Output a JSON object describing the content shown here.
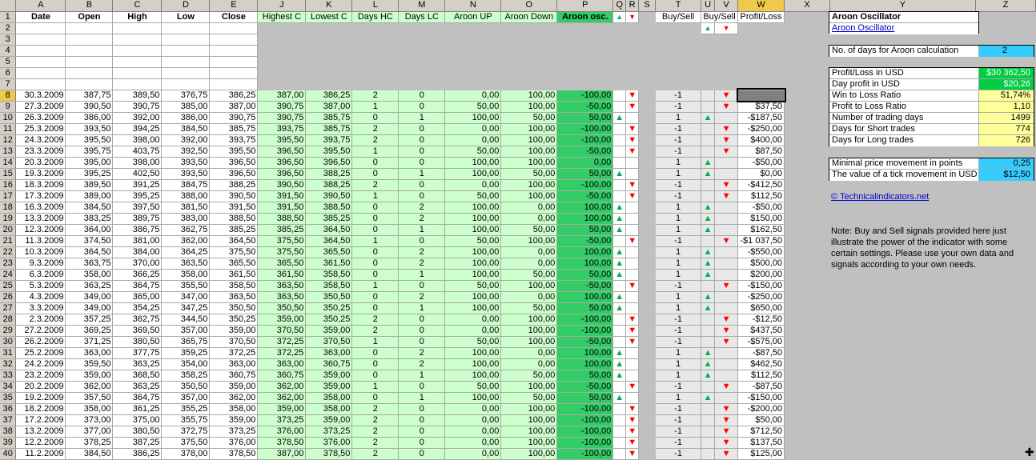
{
  "columns": [
    "A",
    "B",
    "C",
    "D",
    "E",
    "J",
    "K",
    "L",
    "M",
    "N",
    "O",
    "P",
    "Q",
    "R",
    "S",
    "T",
    "U",
    "V",
    "W",
    "X",
    "Y",
    "Z"
  ],
  "row_numbers": [
    "1",
    "2",
    "3",
    "4",
    "5",
    "6",
    "7",
    "8",
    "9",
    "10",
    "11",
    "12",
    "13",
    "14",
    "15",
    "16",
    "17",
    "18",
    "19",
    "20",
    "21",
    "22",
    "23",
    "24",
    "25",
    "26",
    "27",
    "28",
    "29",
    "30",
    "31",
    "32",
    "33",
    "34",
    "35",
    "36",
    "37",
    "38",
    "39",
    "40"
  ],
  "headers": {
    "date": "Date",
    "open": "Open",
    "high": "High",
    "low": "Low",
    "close": "Close",
    "highest_c": "Highest C",
    "lowest_c": "Lowest C",
    "days_hc": "Days HC",
    "days_lc": "Days LC",
    "aroon_up": "Aroon UP",
    "aroon_down": "Aroon Down",
    "aroon_osc": "Aroon osc.",
    "buy_sell": "Buy/Sell",
    "buy_sell2": "Buy/Sell",
    "profit_loss": "Profit/Loss"
  },
  "arrows": {
    "up": "▲",
    "down": "▼"
  },
  "rows": [
    [
      "30.3.2009",
      "387,75",
      "389,50",
      "376,75",
      "386,25",
      "387,00",
      "386,25",
      "2",
      "0",
      "0,00",
      "100,00",
      "-100,00",
      "",
      "▼",
      "",
      "-1",
      "",
      "▼",
      ""
    ],
    [
      "27.3.2009",
      "390,50",
      "390,75",
      "385,00",
      "387,00",
      "390,75",
      "387,00",
      "1",
      "0",
      "50,00",
      "100,00",
      "-50,00",
      "",
      "▼",
      "",
      "-1",
      "",
      "▼",
      "$37,50"
    ],
    [
      "26.3.2009",
      "386,00",
      "392,00",
      "386,00",
      "390,75",
      "390,75",
      "385,75",
      "0",
      "1",
      "100,00",
      "50,00",
      "50,00",
      "▲",
      "",
      "",
      "1",
      "▲",
      "",
      "-$187,50"
    ],
    [
      "25.3.2009",
      "393,50",
      "394,25",
      "384,50",
      "385,75",
      "393,75",
      "385,75",
      "2",
      "0",
      "0,00",
      "100,00",
      "-100,00",
      "",
      "▼",
      "",
      "-1",
      "",
      "▼",
      "-$250,00"
    ],
    [
      "24.3.2009",
      "395,50",
      "398,00",
      "392,00",
      "393,75",
      "395,50",
      "393,75",
      "2",
      "0",
      "0,00",
      "100,00",
      "-100,00",
      "",
      "▼",
      "",
      "-1",
      "",
      "▼",
      "$400,00"
    ],
    [
      "23.3.2009",
      "395,75",
      "403,75",
      "392,50",
      "395,50",
      "396,50",
      "395,50",
      "1",
      "0",
      "50,00",
      "100,00",
      "-50,00",
      "",
      "▼",
      "",
      "-1",
      "",
      "▼",
      "$87,50"
    ],
    [
      "20.3.2009",
      "395,00",
      "398,00",
      "393,50",
      "396,50",
      "396,50",
      "396,50",
      "0",
      "0",
      "100,00",
      "100,00",
      "0,00",
      "",
      "",
      "",
      "1",
      "▲",
      "",
      "-$50,00"
    ],
    [
      "19.3.2009",
      "395,25",
      "402,50",
      "393,50",
      "396,50",
      "396,50",
      "388,25",
      "0",
      "1",
      "100,00",
      "50,00",
      "50,00",
      "▲",
      "",
      "",
      "1",
      "▲",
      "",
      "$0,00"
    ],
    [
      "18.3.2009",
      "389,50",
      "391,25",
      "384,75",
      "388,25",
      "390,50",
      "388,25",
      "2",
      "0",
      "0,00",
      "100,00",
      "-100,00",
      "",
      "▼",
      "",
      "-1",
      "",
      "▼",
      "-$412,50"
    ],
    [
      "17.3.2009",
      "389,00",
      "395,25",
      "388,00",
      "390,50",
      "391,50",
      "390,50",
      "1",
      "0",
      "50,00",
      "100,00",
      "-50,00",
      "",
      "▼",
      "",
      "-1",
      "",
      "▼",
      "$112,50"
    ],
    [
      "16.3.2009",
      "384,50",
      "397,50",
      "381,50",
      "391,50",
      "391,50",
      "388,50",
      "0",
      "2",
      "100,00",
      "0,00",
      "100,00",
      "▲",
      "",
      "",
      "1",
      "▲",
      "",
      "-$50,00"
    ],
    [
      "13.3.2009",
      "383,25",
      "389,75",
      "383,00",
      "388,50",
      "388,50",
      "385,25",
      "0",
      "2",
      "100,00",
      "0,00",
      "100,00",
      "▲",
      "",
      "",
      "1",
      "▲",
      "",
      "$150,00"
    ],
    [
      "12.3.2009",
      "364,00",
      "386,75",
      "362,75",
      "385,25",
      "385,25",
      "364,50",
      "0",
      "1",
      "100,00",
      "50,00",
      "50,00",
      "▲",
      "",
      "",
      "1",
      "▲",
      "",
      "$162,50"
    ],
    [
      "11.3.2009",
      "374,50",
      "381,00",
      "362,00",
      "364,50",
      "375,50",
      "364,50",
      "1",
      "0",
      "50,00",
      "100,00",
      "-50,00",
      "",
      "▼",
      "",
      "-1",
      "",
      "▼",
      "-$1 037,50"
    ],
    [
      "10.3.2009",
      "364,50",
      "384,00",
      "364,25",
      "375,50",
      "375,50",
      "365,50",
      "0",
      "2",
      "100,00",
      "0,00",
      "100,00",
      "▲",
      "",
      "",
      "1",
      "▲",
      "",
      "-$550,00"
    ],
    [
      "9.3.2009",
      "363,75",
      "370,00",
      "363,50",
      "365,50",
      "365,50",
      "361,50",
      "0",
      "2",
      "100,00",
      "0,00",
      "100,00",
      "▲",
      "",
      "",
      "1",
      "▲",
      "",
      "$500,00"
    ],
    [
      "6.3.2009",
      "358,00",
      "366,25",
      "358,00",
      "361,50",
      "361,50",
      "358,50",
      "0",
      "1",
      "100,00",
      "50,00",
      "50,00",
      "▲",
      "",
      "",
      "1",
      "▲",
      "",
      "$200,00"
    ],
    [
      "5.3.2009",
      "363,25",
      "364,75",
      "355,50",
      "358,50",
      "363,50",
      "358,50",
      "1",
      "0",
      "50,00",
      "100,00",
      "-50,00",
      "",
      "▼",
      "",
      "-1",
      "",
      "▼",
      "-$150,00"
    ],
    [
      "4.3.2009",
      "349,00",
      "365,00",
      "347,00",
      "363,50",
      "363,50",
      "350,50",
      "0",
      "2",
      "100,00",
      "0,00",
      "100,00",
      "▲",
      "",
      "",
      "1",
      "▲",
      "",
      "-$250,00"
    ],
    [
      "3.3.2009",
      "349,00",
      "354,25",
      "347,25",
      "350,50",
      "350,50",
      "350,25",
      "0",
      "1",
      "100,00",
      "50,00",
      "50,00",
      "▲",
      "",
      "",
      "1",
      "▲",
      "",
      "$650,00"
    ],
    [
      "2.3.2009",
      "357,25",
      "362,75",
      "344,50",
      "350,25",
      "359,00",
      "350,25",
      "2",
      "0",
      "0,00",
      "100,00",
      "-100,00",
      "",
      "▼",
      "",
      "-1",
      "",
      "▼",
      "-$12,50"
    ],
    [
      "27.2.2009",
      "369,25",
      "369,50",
      "357,00",
      "359,00",
      "370,50",
      "359,00",
      "2",
      "0",
      "0,00",
      "100,00",
      "-100,00",
      "",
      "▼",
      "",
      "-1",
      "",
      "▼",
      "$437,50"
    ],
    [
      "26.2.2009",
      "371,25",
      "380,50",
      "365,75",
      "370,50",
      "372,25",
      "370,50",
      "1",
      "0",
      "50,00",
      "100,00",
      "-50,00",
      "",
      "▼",
      "",
      "-1",
      "",
      "▼",
      "-$575,00"
    ],
    [
      "25.2.2009",
      "363,00",
      "377,75",
      "359,25",
      "372,25",
      "372,25",
      "363,00",
      "0",
      "2",
      "100,00",
      "0,00",
      "100,00",
      "▲",
      "",
      "",
      "1",
      "▲",
      "",
      "-$87,50"
    ],
    [
      "24.2.2009",
      "359,50",
      "363,25",
      "354,00",
      "363,00",
      "363,00",
      "360,75",
      "0",
      "2",
      "100,00",
      "0,00",
      "100,00",
      "▲",
      "",
      "",
      "1",
      "▲",
      "",
      "$462,50"
    ],
    [
      "23.2.2009",
      "359,00",
      "368,50",
      "358,25",
      "360,75",
      "360,75",
      "359,00",
      "0",
      "1",
      "100,00",
      "50,00",
      "50,00",
      "▲",
      "",
      "",
      "1",
      "▲",
      "",
      "$112,50"
    ],
    [
      "20.2.2009",
      "362,00",
      "363,25",
      "350,50",
      "359,00",
      "362,00",
      "359,00",
      "1",
      "0",
      "50,00",
      "100,00",
      "-50,00",
      "",
      "▼",
      "",
      "-1",
      "",
      "▼",
      "-$87,50"
    ],
    [
      "19.2.2009",
      "357,50",
      "364,75",
      "357,00",
      "362,00",
      "362,00",
      "358,00",
      "0",
      "1",
      "100,00",
      "50,00",
      "50,00",
      "▲",
      "",
      "",
      "1",
      "▲",
      "",
      "-$150,00"
    ],
    [
      "18.2.2009",
      "358,00",
      "361,25",
      "355,25",
      "358,00",
      "359,00",
      "358,00",
      "2",
      "0",
      "0,00",
      "100,00",
      "-100,00",
      "",
      "▼",
      "",
      "-1",
      "",
      "▼",
      "-$200,00"
    ],
    [
      "17.2.2009",
      "373,00",
      "375,00",
      "355,75",
      "359,00",
      "373,25",
      "359,00",
      "2",
      "0",
      "0,00",
      "100,00",
      "-100,00",
      "",
      "▼",
      "",
      "-1",
      "",
      "▼",
      "$50,00"
    ],
    [
      "13.2.2009",
      "377,00",
      "380,50",
      "372,75",
      "373,25",
      "376,00",
      "373,25",
      "2",
      "0",
      "0,00",
      "100,00",
      "-100,00",
      "",
      "▼",
      "",
      "-1",
      "",
      "▼",
      "$712,50"
    ],
    [
      "12.2.2009",
      "378,25",
      "387,25",
      "375,50",
      "376,00",
      "378,50",
      "376,00",
      "2",
      "0",
      "0,00",
      "100,00",
      "-100,00",
      "",
      "▼",
      "",
      "-1",
      "",
      "▼",
      "$137,50"
    ],
    [
      "11.2.2009",
      "384,50",
      "386,25",
      "378,00",
      "378,50",
      "387,00",
      "378,50",
      "2",
      "0",
      "0,00",
      "100,00",
      "-100,00",
      "",
      "▼",
      "",
      "-1",
      "",
      "▼",
      "$125,00"
    ]
  ],
  "panel": {
    "title": "Aroon Oscillator",
    "link": "Aroon Oscillator",
    "days_label": "No. of days for Aroon calculation",
    "days_value": "2",
    "stats": [
      {
        "label": "Profit/Loss in USD",
        "value": "$30 362,50"
      },
      {
        "label": "Day profit in USD",
        "value": "$20,26"
      },
      {
        "label": "Win to Loss Ratio",
        "value": "51,74%"
      },
      {
        "label": "Profit to Loss Ratio",
        "value": "1,10"
      },
      {
        "label": "Number of trading days",
        "value": "1499"
      },
      {
        "label": "Days for Short trades",
        "value": "774"
      },
      {
        "label": "Days for Long trades",
        "value": "726"
      }
    ],
    "min_move_label": "Minimal price movement in points",
    "min_move_value": "0,25",
    "tick_label": "The value of a tick movement in USD",
    "tick_value": "$12,50",
    "site_link": "© Technicalindicators.net",
    "note": "Note: Buy and Sell signals provided here just illustrate the power of the indicator with some certain settings. Please use your own data and signals according to your own needs."
  },
  "colors": {
    "green_cell": "#00cc44",
    "yellow_cell": "#ffff99",
    "cyan_cell": "#33ccff",
    "light_green": "#ccffcc",
    "osc_green": "#33cc66",
    "selected_col": "#f0c84c"
  },
  "cursor_icon": "plus-cursor-icon"
}
